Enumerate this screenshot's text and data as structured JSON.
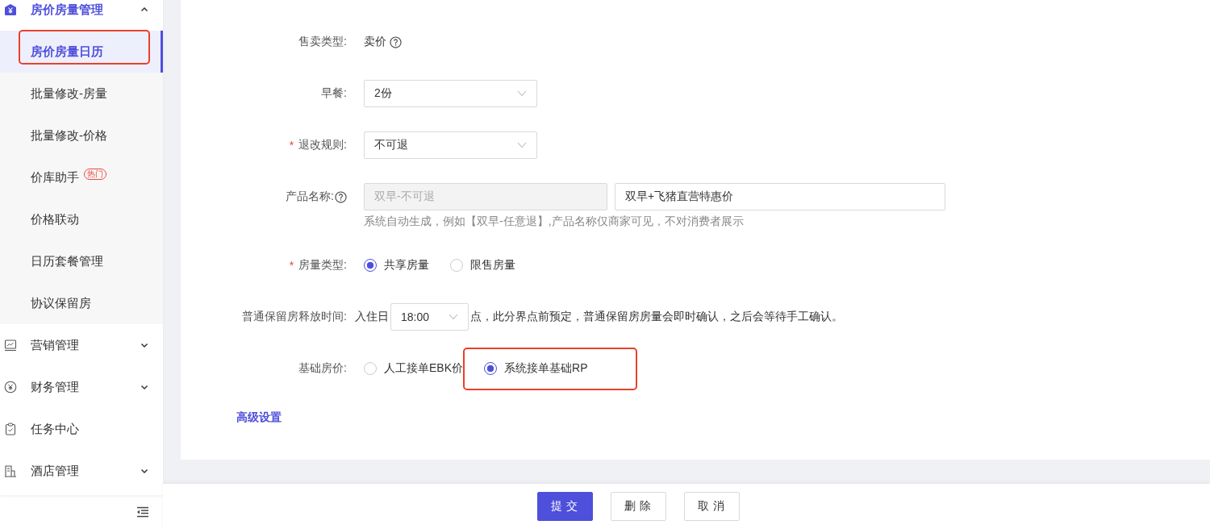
{
  "sidebar": {
    "groups": [
      {
        "label": "房价房量管理",
        "kind": "group",
        "expanded": true,
        "selected": true,
        "children": [
          {
            "label": "房价房量日历",
            "selected": true,
            "annotated": true
          },
          {
            "label": "批量修改-房量",
            "selected": false,
            "annotated": false
          },
          {
            "label": "批量修改-价格",
            "selected": false,
            "annotated": false
          },
          {
            "label": "价库助手",
            "selected": false,
            "annotated": false,
            "badge": "热门"
          },
          {
            "label": "价格联动",
            "selected": false,
            "annotated": false
          },
          {
            "label": "日历套餐管理",
            "selected": false,
            "annotated": false
          },
          {
            "label": "协议保留房",
            "selected": false,
            "annotated": false
          }
        ]
      },
      {
        "label": "营销管理",
        "kind": "group",
        "expanded": false,
        "selected": false
      },
      {
        "label": "财务管理",
        "kind": "group",
        "expanded": false,
        "selected": false
      },
      {
        "label": "任务中心",
        "kind": "link",
        "selected": false
      },
      {
        "label": "酒店管理",
        "kind": "group",
        "expanded": false,
        "selected": false
      }
    ]
  },
  "form": {
    "fields": [
      {
        "kind": "text",
        "label": "售卖类型:",
        "value": "卖价"
      },
      {
        "kind": "select",
        "label": "早餐:",
        "value": "2份"
      },
      {
        "kind": "select",
        "label": "退改规则:",
        "required_mark": "*",
        "value": "不可退"
      },
      {
        "kind": "name",
        "label": "产品名称:",
        "auto_value": "双早-不可退",
        "value": "双早+飞猪直营特惠价",
        "hint": "系统自动生成，例如【双早-任意退】,产品名称仅商家可见，不对消费者展示"
      },
      {
        "kind": "radio",
        "label": "房量类型:",
        "required_mark": "*",
        "options": [
          {
            "label": "共享房量",
            "selected": true,
            "annotated": false
          },
          {
            "label": "限售房量",
            "selected": false,
            "annotated": false
          }
        ]
      },
      {
        "kind": "time",
        "label": "普通保留房释放时间:",
        "prefix": "入住日",
        "value": "18:00",
        "suffix": "点，此分界点前预定，普通保留房房量会即时确认，之后会等待手工确认。"
      },
      {
        "kind": "radio",
        "label": "基础房价:",
        "options": [
          {
            "label": "人工接单EBK价",
            "selected": false,
            "annotated": false
          },
          {
            "label": "系统接单基础RP",
            "selected": true,
            "annotated": true
          }
        ]
      }
    ],
    "advanced_link": "高级设置"
  },
  "buttons": [
    {
      "label": "提 交",
      "kind": "primary"
    },
    {
      "label": "删 除",
      "kind": "default"
    },
    {
      "label": "取 消",
      "kind": "default"
    }
  ]
}
